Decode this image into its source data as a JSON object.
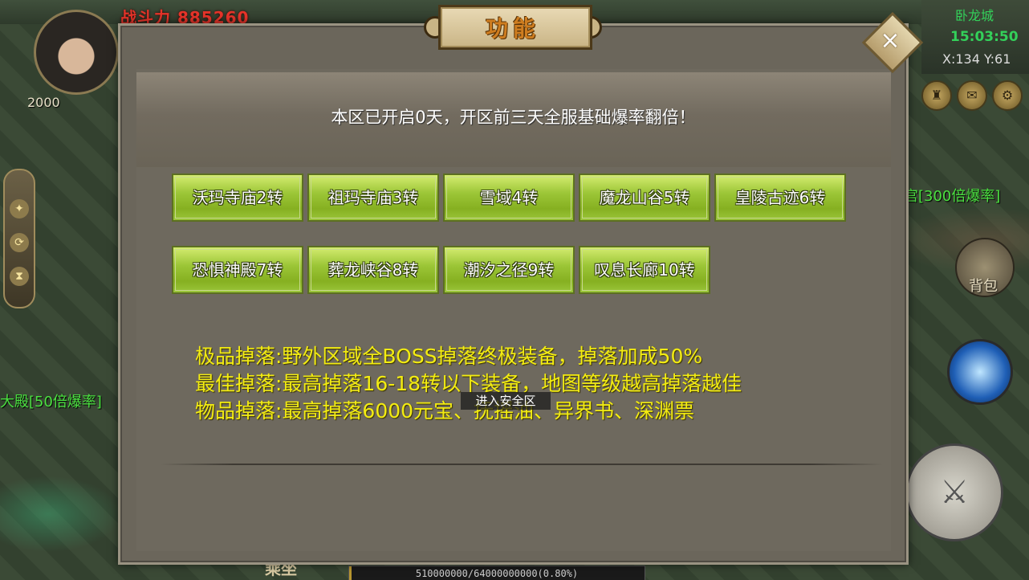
{
  "hud": {
    "power_label": "战斗力 885260",
    "level": "2000",
    "left_hall_text": "大殿[50倍爆率]",
    "map_name": "卧龙城",
    "clock": "15:03:50",
    "coords": "X:134  Y:61",
    "right_green_text": "宫[300倍爆率]",
    "bag_label": "背包",
    "ride_label": "乘坐",
    "exp_text": "510000000/64000000000(0.80%)",
    "exp_percent": 0.8
  },
  "panel": {
    "title": "功能",
    "close_symbol": "×",
    "notice": "本区已开启0天，开区前三天全服基础爆率翻倍！",
    "zones_row1": [
      "沃玛寺庙2转",
      "祖玛寺庙3转",
      "雪域4转",
      "魔龙山谷5转",
      "皇陵古迹6转"
    ],
    "zones_row2": [
      "恐惧神殿7转",
      "葬龙峡谷8转",
      "潮汐之径9转",
      "叹息长廊10转"
    ],
    "drops": [
      "极品掉落:野外区域全BOSS掉落终极装备，掉落加成50%",
      "最佳掉落:最高掉落16-18转以下装备，地图等级越高掉落越佳",
      "物品掉落:最高掉落6000元宝、抚摇油、异界书、深渊票"
    ],
    "safe_zone_toast": "进入安全区"
  },
  "colors": {
    "zone_button": "#9cc637",
    "drop_text": "#f3ec12",
    "hud_green": "#33d15a",
    "power_red": "#e7342a"
  },
  "icons": [
    "trophy-icon",
    "mail-icon",
    "settings-icon",
    "boss-icon",
    "bag-icon",
    "skill-icon",
    "sword-icon"
  ]
}
